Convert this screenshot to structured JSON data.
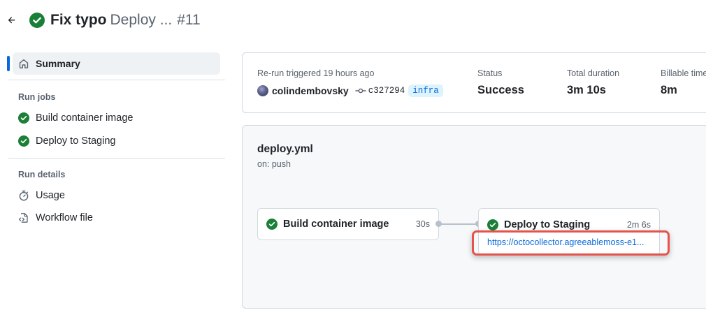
{
  "header": {
    "back_icon": "arrow-left-icon",
    "status_icon": "check-circle-fill-icon",
    "title": "Fix typo",
    "workflow": "Deploy ...",
    "run_number": "#11"
  },
  "sidebar": {
    "summary": {
      "label": "Summary",
      "icon": "home-icon"
    },
    "run_jobs_heading": "Run jobs",
    "jobs": [
      {
        "label": "Build container image",
        "icon": "check-circle-fill-icon"
      },
      {
        "label": "Deploy to Staging",
        "icon": "check-circle-fill-icon"
      }
    ],
    "run_details_heading": "Run details",
    "details": [
      {
        "label": "Usage",
        "icon": "stopwatch-icon"
      },
      {
        "label": "Workflow file",
        "icon": "file-code-icon"
      }
    ]
  },
  "summary_card": {
    "trigger_text": "Re-run triggered 19 hours ago",
    "actor": "colindembovsky",
    "commit_sha": "c327294",
    "branch": "infra",
    "status_label": "Status",
    "status_value": "Success",
    "duration_label": "Total duration",
    "duration_value": "3m 10s",
    "billable_label": "Billable time",
    "billable_value": "8m"
  },
  "graph": {
    "workflow_file": "deploy.yml",
    "trigger": "on: push",
    "jobs": [
      {
        "label": "Build container image",
        "duration": "30s"
      },
      {
        "label": "Deploy to Staging",
        "duration": "2m 6s"
      }
    ],
    "deploy_url": "https://octocollector.agreeablemoss-e1..."
  },
  "colors": {
    "success": "#1a7f37",
    "accent": "#0969da",
    "highlight": "#e5534b"
  }
}
